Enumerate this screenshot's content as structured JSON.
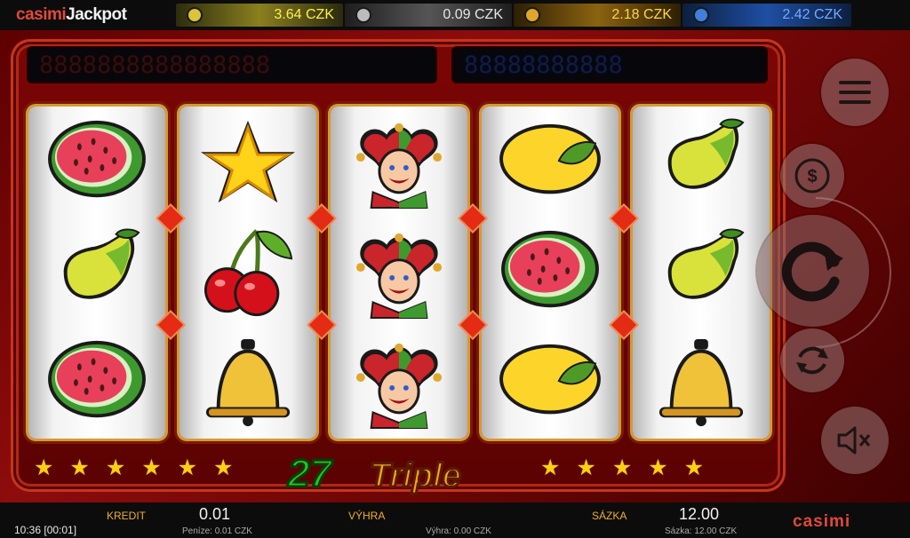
{
  "brand": {
    "part1": "casimi",
    "part2": "Jackpot"
  },
  "jackpots": [
    {
      "value": "3.64 CZK",
      "color": "#fff14a"
    },
    {
      "value": "0.09 CZK",
      "color": "#e6e6e6"
    },
    {
      "value": "2.18 CZK",
      "color": "#ffd54a"
    },
    {
      "value": "2.42 CZK",
      "color": "#72a9ff"
    }
  ],
  "led_displays": {
    "left": "8888888888888888",
    "right": "88888888888"
  },
  "reels": [
    [
      "watermelon",
      "pear",
      "watermelon"
    ],
    [
      "star",
      "cherries",
      "bell"
    ],
    [
      "joker",
      "joker",
      "joker"
    ],
    [
      "lemon",
      "watermelon",
      "lemon"
    ],
    [
      "pear",
      "pear",
      "bell"
    ]
  ],
  "game_logo": {
    "number": "27",
    "word": "Triple"
  },
  "stars_left": "★★★★★★",
  "stars_right": "★★★★★",
  "controls": {
    "menu": "menu-icon",
    "cash": "dollar-icon",
    "spin": "spin-icon",
    "autoplay": "autoplay-icon",
    "sound": "sound-off-icon"
  },
  "status": {
    "time": "10:36 [00:01]",
    "kredit_label": "KREDIT",
    "kredit_value": "0.01",
    "kredit_sub": "Peníze: 0.01 CZK",
    "vyhra_label": "VÝHRA",
    "vyhra_sub": "Výhra: 0.00 CZK",
    "sazka_label": "SÁZKA",
    "sazka_value": "12.00",
    "sazka_sub": "Sázka: 12.00 CZK",
    "logo": "casimi"
  },
  "colors": {
    "accent": "#e42b14",
    "gold": "#ffcf14",
    "background": "#7c0505"
  }
}
